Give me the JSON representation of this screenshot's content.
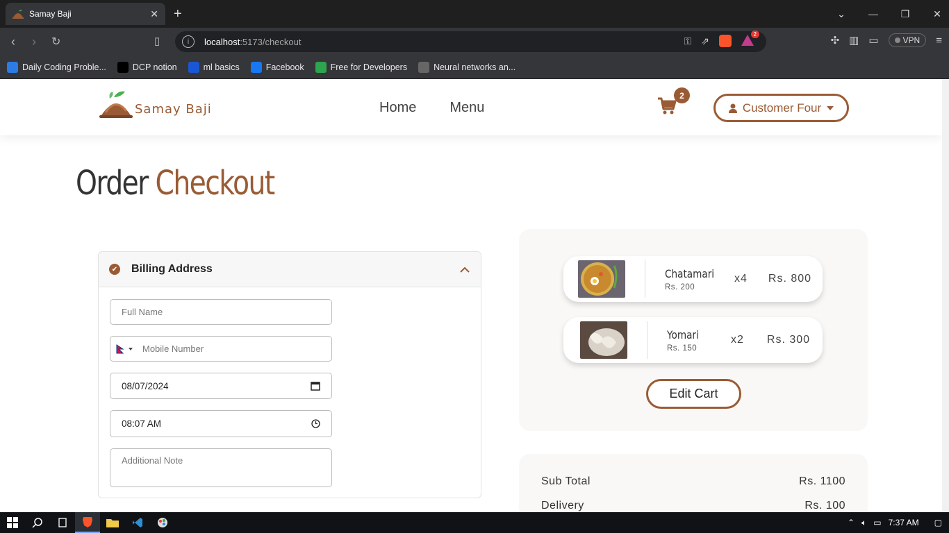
{
  "browser": {
    "tab_title": "Samay Baji",
    "url_host": "localhost",
    "url_path": ":5173/checkout",
    "vpn_label": "VPN",
    "rewards_count": "2",
    "bookmarks": [
      {
        "label": "Daily Coding Proble...",
        "color": "#2d7be5"
      },
      {
        "label": "DCP notion",
        "color": "#000000"
      },
      {
        "label": "ml basics",
        "color": "#1a57d6"
      },
      {
        "label": "Facebook",
        "color": "#1877f2"
      },
      {
        "label": "Free for Developers",
        "color": "#2da44e"
      },
      {
        "label": "Neural networks an...",
        "color": "#666666"
      }
    ]
  },
  "header": {
    "logo_text": "Samay Baji",
    "nav": [
      "Home",
      "Menu"
    ],
    "cart_count": "2",
    "user_name": "Customer Four"
  },
  "page": {
    "title_part1": "Order",
    "title_part2": "Checkout"
  },
  "billing": {
    "section_title": "Billing Address",
    "full_name_placeholder": "Full Name",
    "mobile_placeholder": "Mobile Number",
    "date_value": "08/07/2024",
    "time_value": "08:07 AM",
    "note_placeholder": "Additional Note"
  },
  "cart": {
    "items": [
      {
        "name": "Chatamari",
        "unit_price": "Rs. 200",
        "qty": "x4",
        "total": "Rs. 800"
      },
      {
        "name": "Yomari",
        "unit_price": "Rs. 150",
        "qty": "x2",
        "total": "Rs. 300"
      }
    ],
    "edit_label": "Edit Cart"
  },
  "summary": {
    "subtotal_label": "Sub Total",
    "subtotal_value": "Rs. 1100",
    "delivery_label": "Delivery",
    "delivery_value": "Rs. 100"
  },
  "taskbar": {
    "time": "7:37 AM"
  },
  "colors": {
    "accent": "#9a5b34"
  }
}
